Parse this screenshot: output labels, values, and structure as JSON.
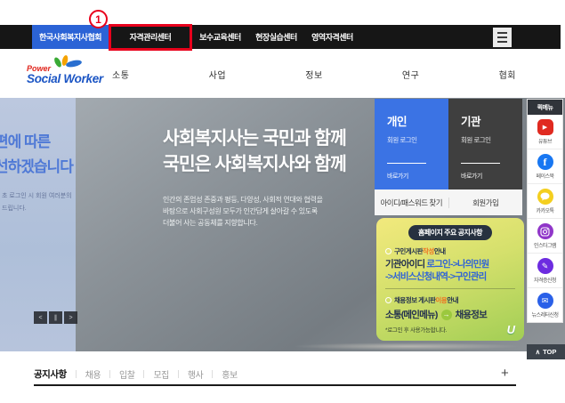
{
  "colors": {
    "accent-blue": "#2b63d6",
    "card-blue": "#3b73e4",
    "card-dark": "#3f3f3f",
    "annotation-red": "#e8001c",
    "notice-yellow": "#f2e97d",
    "notice-green": "#a2ce55",
    "link-blue": "#2e63d6",
    "em-orange": "#ee7222",
    "navy": "#22304e",
    "youtube-red": "#e02a20",
    "facebook-blue": "#1877f2",
    "kakao-yellow": "#f4cf1f",
    "instagram-purple": "#9036c9",
    "cert-violet": "#6d2ce0",
    "newsletter-blue": "#2a60e8"
  },
  "annotation": {
    "step_badge": "1"
  },
  "util_nav": {
    "tabs": [
      {
        "label": "한국사회복지사협회"
      },
      {
        "label": "자격관리센터"
      },
      {
        "label": "보수교육센터"
      },
      {
        "label": "현장실습센터"
      },
      {
        "label": "영역자격센터"
      }
    ]
  },
  "header": {
    "logo_top": "Power",
    "logo_bottom": "Social Worker",
    "menu": [
      {
        "label": "소통"
      },
      {
        "label": "사업"
      },
      {
        "label": "정보"
      },
      {
        "label": "연구"
      },
      {
        "label": "협회"
      }
    ]
  },
  "hero": {
    "prev_slide": {
      "heading_line1": "편에 따른",
      "heading_line2": "선하겠습니다",
      "note_line1": "초 로그인 시 회원 여러분의",
      "note_line2": "드립니다."
    },
    "heading_line1": "사회복지사는 국민과 함께",
    "heading_line2": "국민은 사회복지사와 함께",
    "desc_line1": "인간의 존엄성 존중과 평등, 다양성, 사회적 연대와 협력을",
    "desc_line2": "바탕으로 사회구성원 모두가 인간답게 살아갈 수 있도록",
    "desc_line3": "더불어 사는 공동체를 지향합니다.",
    "controls": {
      "prev": "<",
      "pause": "∥",
      "next": ">"
    }
  },
  "login_panel": {
    "personal": {
      "title": "개인",
      "subtitle": "회원 로그인",
      "link": "바로가기"
    },
    "org": {
      "title": "기관",
      "subtitle": "회원 로그인",
      "link": "바로가기"
    },
    "find_link": "아이디/패스워드 찾기",
    "join_link": "회원가입"
  },
  "notice_card": {
    "badge": "홈페이지 주요 공지사항",
    "item1": {
      "prefix": "구인게시판 ",
      "em": "작성",
      "suffix": " 안내"
    },
    "path_dark": "기관아이디 ",
    "path_blue1": "로그인->나의민원",
    "path_blue2": "->서비스신청내역->구인관리",
    "item2": {
      "prefix": "채용정보 게시판 ",
      "em": "이용",
      "suffix": " 안내"
    },
    "route_from": "소통(메인메뉴)",
    "route_arrow": "→",
    "route_to": "채용정보",
    "footnote": "*로그인 후 사용가능합니다.",
    "logo": "U"
  },
  "quickmenu": {
    "title": "퀵메뉴",
    "items": [
      {
        "label": "유튜브",
        "glyph": "▶"
      },
      {
        "label": "페이스북",
        "glyph": "f"
      },
      {
        "label": "카카오톡",
        "glyph": ""
      },
      {
        "label": "인스타그램",
        "glyph": ""
      },
      {
        "label": "자격증신청",
        "glyph": "✎"
      },
      {
        "label": "뉴스레터신청",
        "glyph": "✉"
      }
    ],
    "top_icon": "∧",
    "top_button": "TOP"
  },
  "news": {
    "tabs": [
      {
        "label": "공지사항"
      },
      {
        "label": "채용"
      },
      {
        "label": "입찰"
      },
      {
        "label": "모집"
      },
      {
        "label": "행사"
      },
      {
        "label": "홍보"
      }
    ],
    "more": "+"
  }
}
